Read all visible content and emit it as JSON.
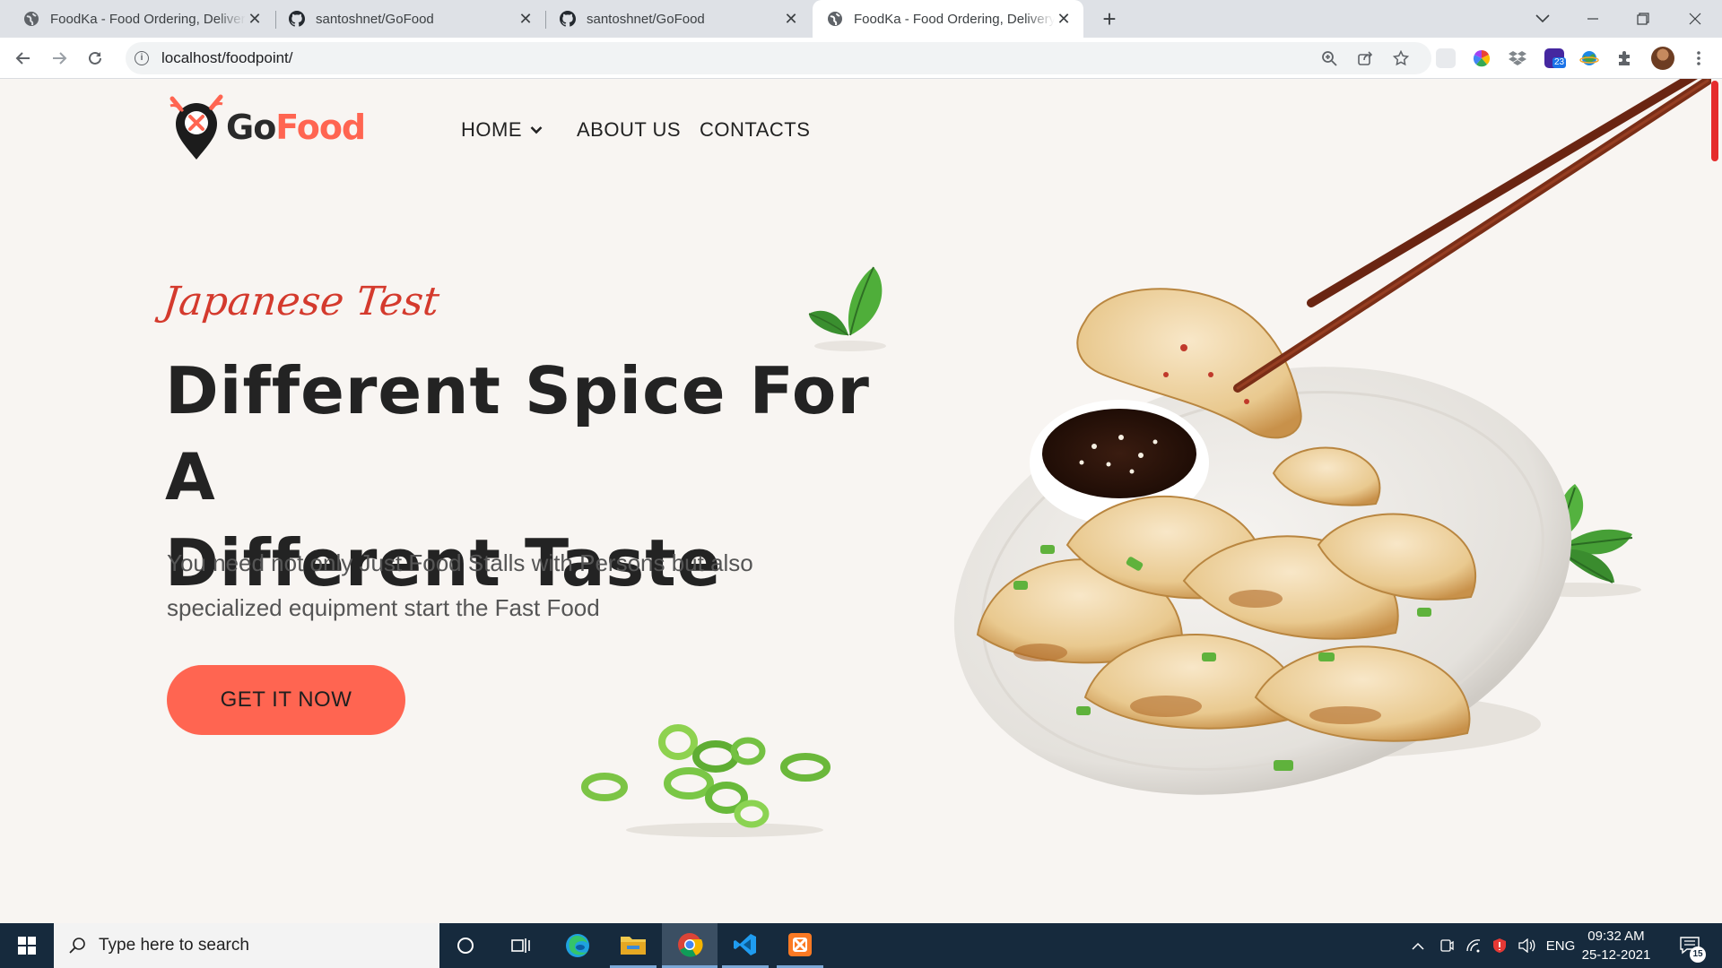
{
  "browser": {
    "tabs": [
      {
        "title": "FoodKa - Food Ordering, Delivery",
        "icon": "globe-icon",
        "active": false
      },
      {
        "title": "santoshnet/GoFood",
        "icon": "github-icon",
        "active": false
      },
      {
        "title": "santoshnet/GoFood",
        "icon": "github-icon",
        "active": false
      },
      {
        "title": "FoodKa - Food Ordering, Delivery",
        "icon": "globe-icon",
        "active": true
      }
    ],
    "url": "localhost/foodpoint/",
    "extension_badge": "23"
  },
  "site": {
    "logo": {
      "part1": "Go",
      "part2": "Food"
    },
    "nav": {
      "home": "HOME",
      "about": "ABOUT US",
      "contacts": "CONTACTS"
    },
    "hero": {
      "subtitle": "Japanese Test",
      "headline_line1": "Different Spice For A",
      "headline_line2": "Different Taste",
      "description_line1": "You need not only Just Food Stalls with Persons but also",
      "description_line2": "specialized equipment start the Fast Food",
      "cta": "GET IT NOW"
    }
  },
  "colors": {
    "accent": "#ff6551",
    "subtitle": "#d43a2d",
    "taskbar": "#162a3d"
  },
  "taskbar": {
    "search_placeholder": "Type here to search",
    "language": "ENG",
    "time": "09:32 AM",
    "date": "25-12-2021",
    "notifications": "15"
  }
}
